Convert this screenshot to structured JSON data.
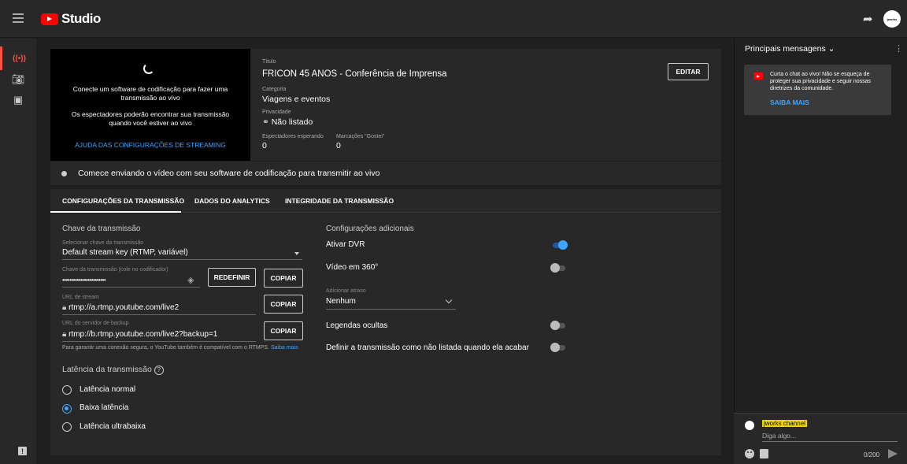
{
  "app": {
    "studio_label": "Studio",
    "avatar_text": "jworks"
  },
  "preview": {
    "msg1": "Conecte um software de codificação para fazer uma transmissão ao vivo",
    "msg2": "Os espectadores poderão encontrar sua transmissão quando você estiver ao vivo",
    "help_link": "AJUDA DAS CONFIGURAÇÕES DE STREAMING"
  },
  "info": {
    "title_label": "Título",
    "title": "FRICON 45 ANOS - Conferência de Imprensa",
    "category_label": "Categoria",
    "category": "Viagens e eventos",
    "privacy_label": "Privacidade",
    "privacy": "Não listado",
    "waiting_label": "Espectadores esperando",
    "waiting": "0",
    "likes_label": "Marcações \"Gostei\"",
    "likes": "0",
    "edit_label": "EDITAR"
  },
  "status": {
    "text": "Comece enviando o vídeo com seu software de codificação para transmitir ao vivo"
  },
  "tabs": [
    {
      "label": "CONFIGURAÇÕES DA TRANSMISSÃO"
    },
    {
      "label": "DADOS DO ANALYTICS"
    },
    {
      "label": "INTEGRIDADE DA TRANSMISSÃO"
    }
  ],
  "stream_key": {
    "section_title": "Chave da transmissão",
    "select_label": "Selecionar chave da transmissão",
    "select_value": "Default stream key (RTMP, variável)",
    "key_label": "Chave da transmissão (cole no codificador)",
    "key_value": "••••••••••••••••••••••••",
    "reset_label": "REDEFINIR",
    "copy_label": "COPIAR",
    "url_label": "URL de stream",
    "url_value": "rtmp://a.rtmp.youtube.com/live2",
    "backup_label": "URL do servidor de backup",
    "backup_value": "rtmp://b.rtmp.youtube.com/live2?backup=1",
    "note": "Para garantir uma conexão segura, o YouTube também é compatível com o RTMPS.",
    "note_link": "Saiba mais"
  },
  "latency": {
    "section_title": "Latência da transmissão",
    "options": [
      {
        "label": "Latência normal",
        "selected": false
      },
      {
        "label": "Baixa latência",
        "selected": true
      },
      {
        "label": "Latência ultrabaixa",
        "selected": false
      }
    ]
  },
  "additional": {
    "section_title": "Configurações adicionais",
    "dvr": "Ativar DVR",
    "dvr_on": true,
    "video360": "Vídeo em 360°",
    "video360_on": false,
    "delay_label": "Adicionar atraso",
    "delay_value": "Nenhum",
    "captions": "Legendas ocultas",
    "captions_on": false,
    "unlisted_end": "Definir a transmissão como não listada quando ela acabar",
    "unlisted_end_on": false
  },
  "chat": {
    "title": "Principais mensagens",
    "banner_text": "Curta o chat ao vivo! Não se esqueça de proteger sua privacidade e seguir nossas diretrizes da comunidade.",
    "banner_link": "SAIBA MAIS",
    "username": "jworks channel",
    "placeholder": "Diga algo...",
    "counter": "0/200"
  },
  "colors": {
    "accent": "#3ea6ff",
    "brand": "#ff0000",
    "username_bg": "#f0d400"
  }
}
